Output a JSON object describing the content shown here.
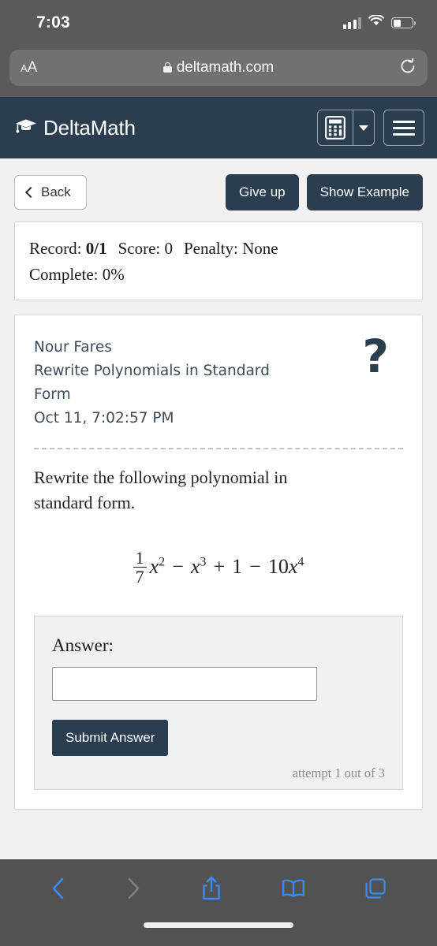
{
  "status_bar": {
    "time": "7:03",
    "signal_icon": "cellular-signal-icon",
    "wifi_icon": "wifi-icon",
    "battery_icon": "battery-icon"
  },
  "browser": {
    "text_size_label": "AA",
    "lock_icon": "lock-icon",
    "url": "deltamath.com",
    "reload_glyph": "↻",
    "toolbar": {
      "back_label": "back-icon",
      "forward_label": "forward-icon",
      "share_label": "share-icon",
      "bookmarks_label": "bookmarks-icon",
      "tabs_label": "tabs-icon"
    }
  },
  "navbar": {
    "brand": "DeltaMath",
    "logo_icon": "graduation-cap-icon",
    "calculator_icon": "calculator-icon",
    "calculator_caret": "chevron-down-icon",
    "menu_icon": "hamburger-menu-icon",
    "accent_color": "#2b3e50"
  },
  "actions": {
    "back_label": "Back",
    "give_up_label": "Give up",
    "show_example_label": "Show Example"
  },
  "record": {
    "record_label": "Record:",
    "record_value": "0/1",
    "score_label": "Score:",
    "score_value": "0",
    "penalty_label": "Penalty:",
    "penalty_value": "None",
    "complete_label": "Complete:",
    "complete_value": "0%"
  },
  "problem": {
    "student_name": "Nour Fares",
    "assignment_title": "Rewrite Polynomials in Standard Form",
    "timestamp": "Oct 11, 7:02:57 PM",
    "help_icon": "question-mark-icon",
    "prompt": "Rewrite the following polynomial in standard form.",
    "expression": {
      "fraction_numerator": "1",
      "fraction_denominator": "7",
      "term1_var": "x",
      "term1_exp": "2",
      "op1": "−",
      "term2_var": "x",
      "term2_exp": "3",
      "op2": "+",
      "term3": "1",
      "op3": "−",
      "term4_coef": "10",
      "term4_var": "x",
      "term4_exp": "4",
      "plain": "1/7 x^2 - x^3 + 1 - 10x^4"
    }
  },
  "answer": {
    "label": "Answer:",
    "value": "",
    "placeholder": "",
    "submit_label": "Submit Answer",
    "attempt_text": "attempt 1 out of 3"
  }
}
